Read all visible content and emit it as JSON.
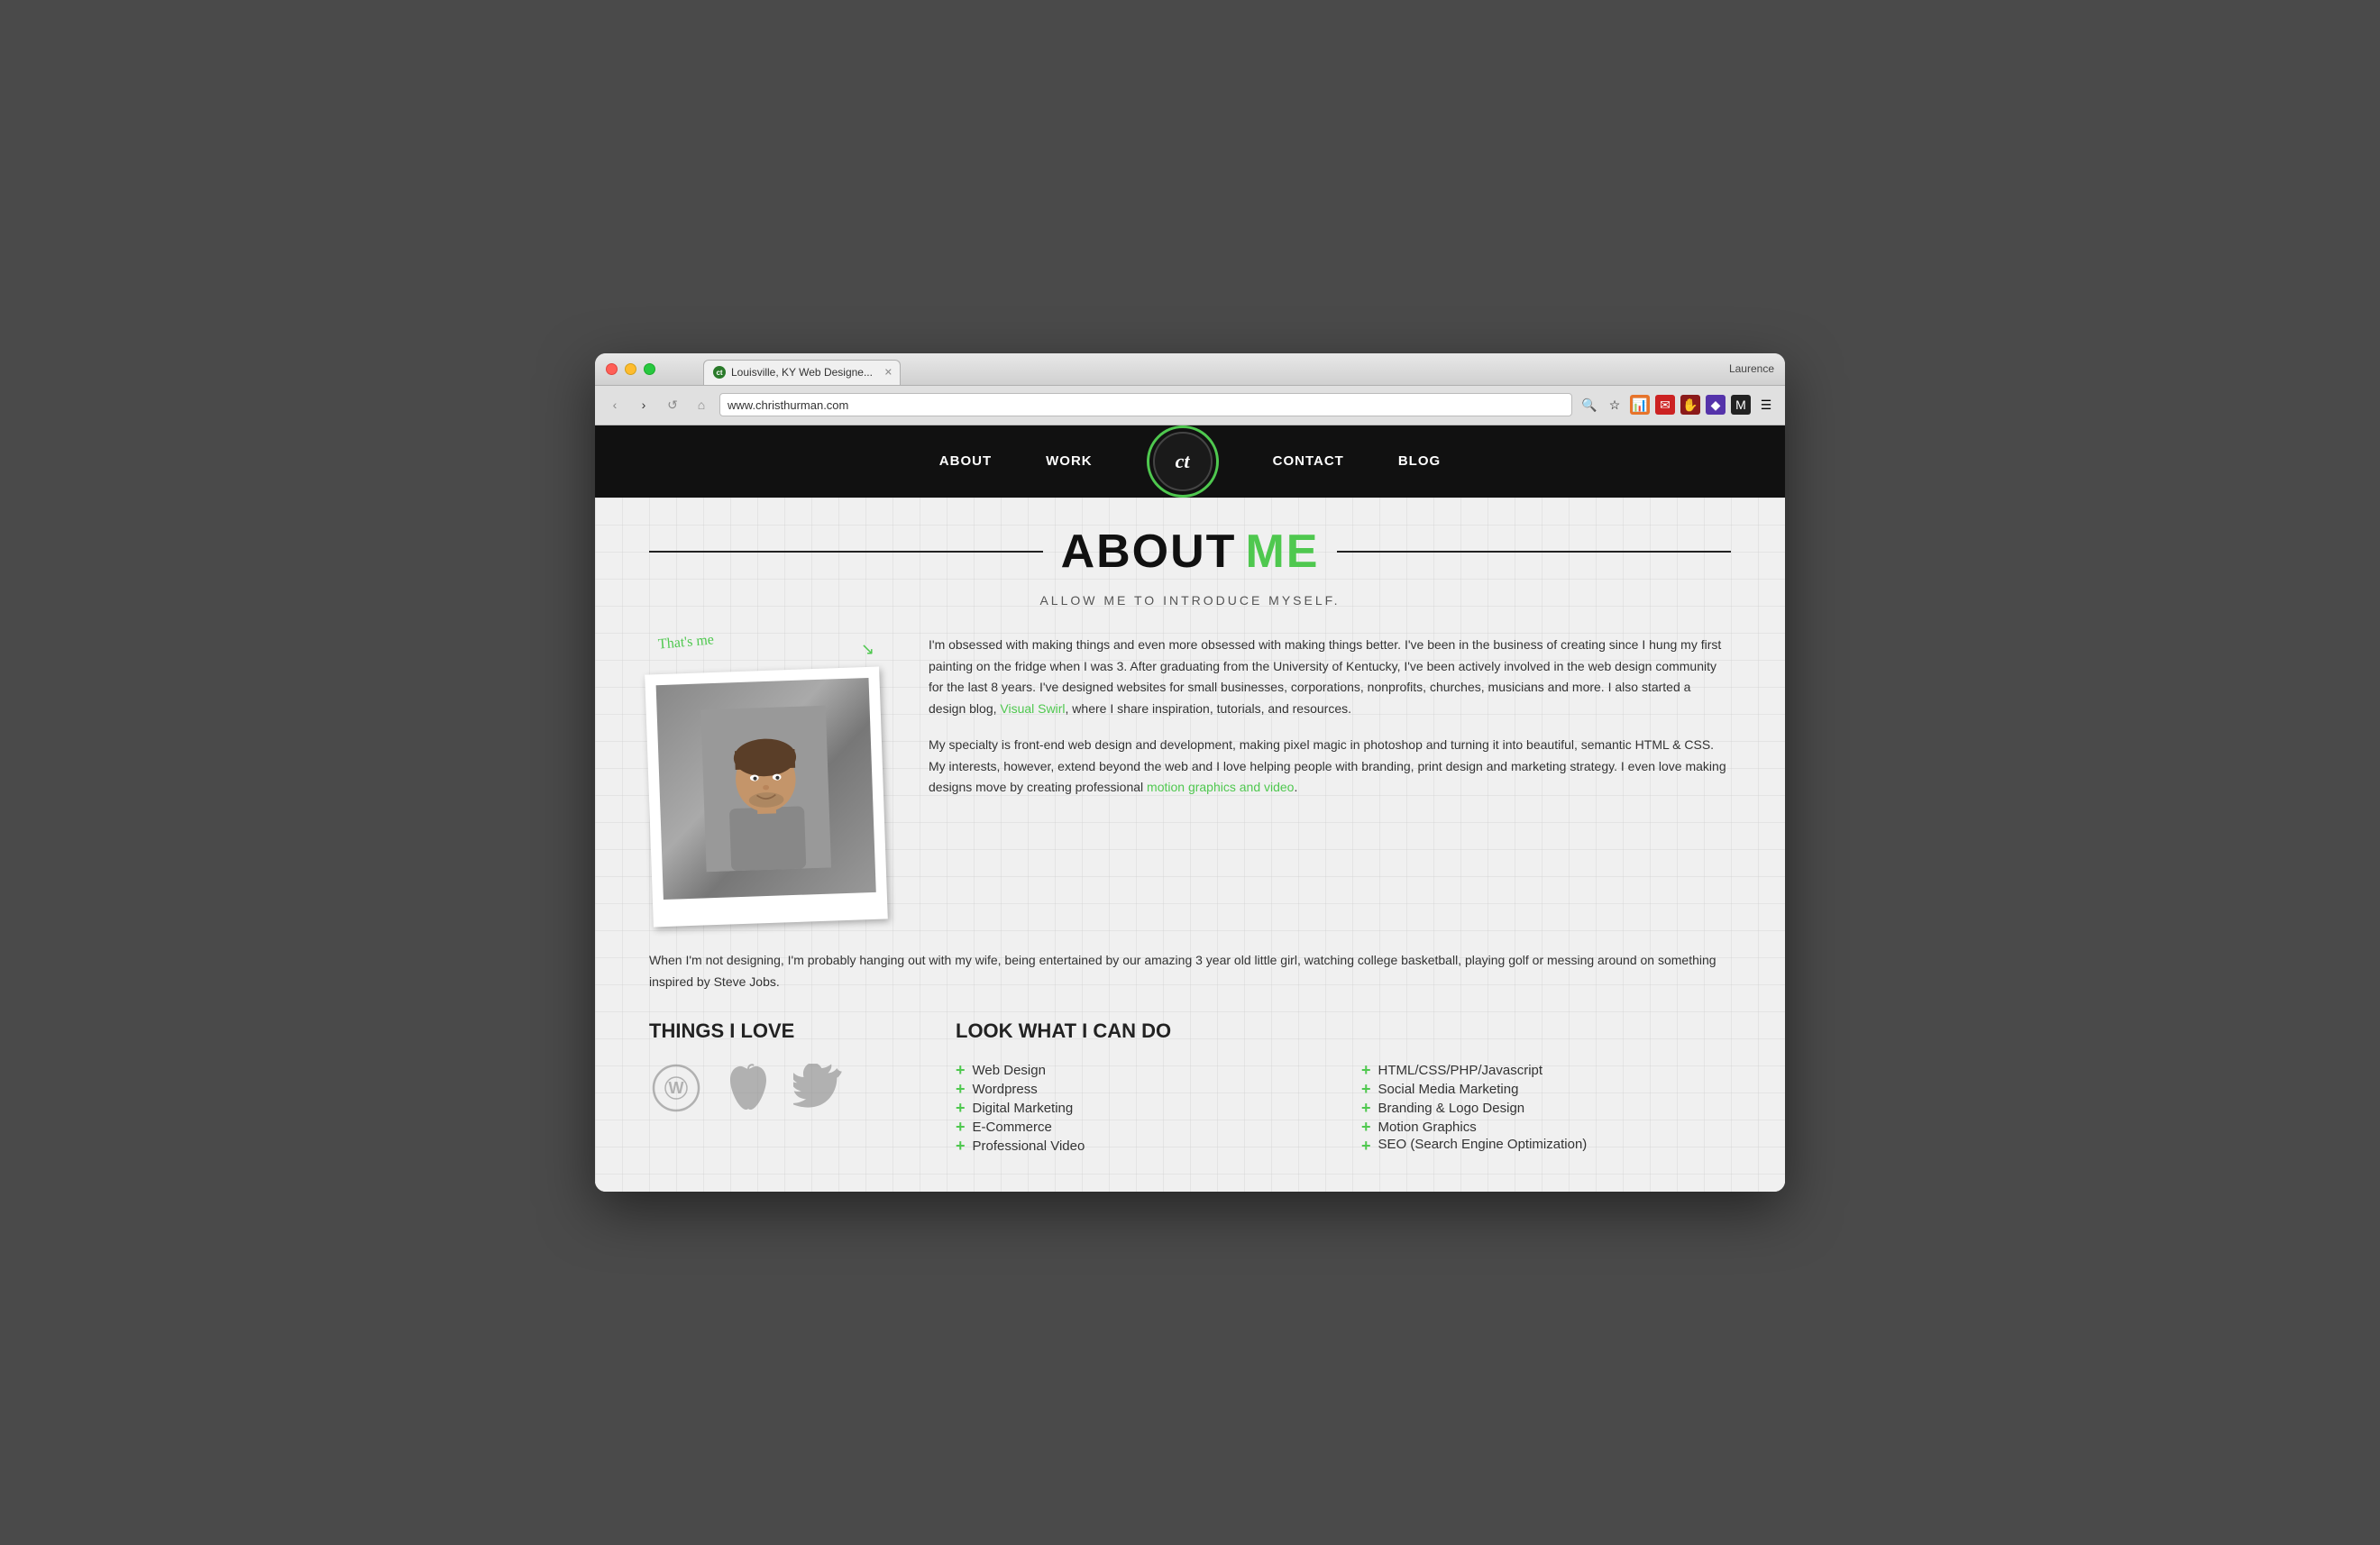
{
  "browser": {
    "tab_favicon": "ct",
    "tab_title": "Louisville, KY Web Designe...",
    "address": "www.christhurman.com",
    "user": "Laurence"
  },
  "nav": {
    "about": "ABOUT",
    "work": "WORK",
    "contact": "CONTACT",
    "blog": "BLOG",
    "logo": "ct"
  },
  "about": {
    "heading_black": "ABOUT",
    "heading_green": "ME",
    "subtitle": "ALLOW ME TO INTRODUCE MYSELF.",
    "thats_me": "That's me",
    "bio_p1": "I'm obsessed with making things and even more obsessed with making things better. I've been in the business of creating since I hung my first painting on the fridge when I was 3. After graduating from the University of Kentucky, I've been actively involved in the web design community for the last 8 years. I've designed websites for small businesses, corporations, nonprofits, churches, musicians and more. I also started a design blog, Visual Swirl, where I share inspiration, tutorials, and resources.",
    "bio_link1": "Visual Swirl",
    "bio_p2_start": "My specialty is front-end web design and development, making pixel magic in photoshop and turning it into beautiful, semantic HTML & CSS. My interests, however, extend beyond the web and I love helping people with branding, print design and marketing strategy. I even love making designs move by creating professional ",
    "bio_link2": "motion graphics and video",
    "bio_p2_end": ".",
    "personal": "When I'm not designing, I'm probably hanging out with my wife, being entertained by our amazing 3 year old little girl, watching college basketball, playing golf or messing around on something inspired by Steve Jobs.",
    "things_title": "THINGS I LOVE",
    "can_do_title": "LOOK WHAT I CAN DO",
    "skills_col1": [
      "Web Design",
      "Wordpress",
      "Digital Marketing",
      "E-Commerce",
      "Professional Video"
    ],
    "skills_col2": [
      "HTML/CSS/PHP/Javascript",
      "Social Media Marketing",
      "Branding & Logo Design",
      "Motion Graphics",
      "SEO (Search Engine Optimization)"
    ]
  }
}
